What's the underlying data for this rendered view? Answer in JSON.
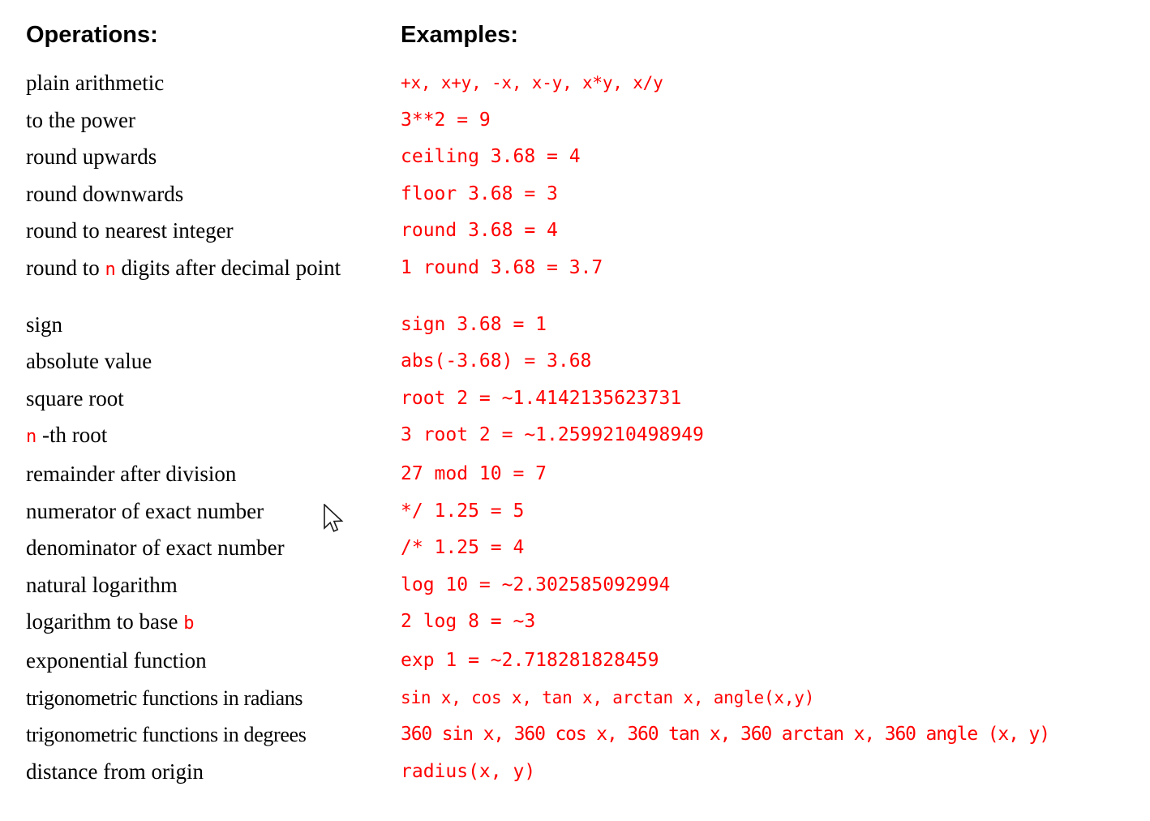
{
  "header": {
    "operations_label": "Operations:",
    "examples_label": "Examples:"
  },
  "colors": {
    "example_text": "#ff0000",
    "operation_text": "#000000",
    "background": "#ffffff",
    "parameter_highlight": "#ff0000"
  },
  "rows": [
    {
      "operation": "plain arithmetic",
      "example": "+x, x+y, -x, x-y, x*y, x/y"
    },
    {
      "operation": "to the power",
      "example": "3**2 = 9"
    },
    {
      "operation": "round upwards",
      "example": "ceiling 3.68 = 4"
    },
    {
      "operation": "round downwards",
      "example": "floor 3.68 = 3"
    },
    {
      "operation": "round to nearest integer",
      "example": "round 3.68 = 4"
    },
    {
      "operation_pre": "round to ",
      "operation_param": "n",
      "operation_post": " digits after decimal point",
      "example": "1 round 3.68 = 3.7"
    },
    {
      "operation": "sign",
      "example": "sign 3.68 = 1"
    },
    {
      "operation": "absolute value",
      "example": "abs(-3.68) = 3.68"
    },
    {
      "operation": "square root",
      "example": "root 2 = ~1.4142135623731"
    },
    {
      "operation_pre": "",
      "operation_param": "n",
      "operation_post": " -th root",
      "example": "3 root 2 = ~1.2599210498949"
    },
    {
      "operation": "remainder after division",
      "example": "27 mod 10 = 7"
    },
    {
      "operation": "numerator of exact number",
      "example": "*/ 1.25 = 5"
    },
    {
      "operation": "denominator of exact number",
      "example": "/* 1.25 = 4"
    },
    {
      "operation": "natural logarithm",
      "example": "log 10 = ~2.302585092994"
    },
    {
      "operation_pre": "logarithm to base ",
      "operation_param": "b",
      "operation_post": "",
      "example": "2 log 8 = ~3"
    },
    {
      "operation": "exponential function",
      "example": "exp 1 = ~2.718281828459"
    },
    {
      "operation": "trigonometric functions in radians",
      "example": "sin x, cos x, tan x, arctan x, angle(x,y)"
    },
    {
      "operation": "trigonometric functions in degrees",
      "example": "360 sin x, 360 cos x, 360 tan x, 360 arctan x, 360 angle (x, y)"
    },
    {
      "operation": "distance from origin",
      "example": "radius(x, y)"
    }
  ]
}
